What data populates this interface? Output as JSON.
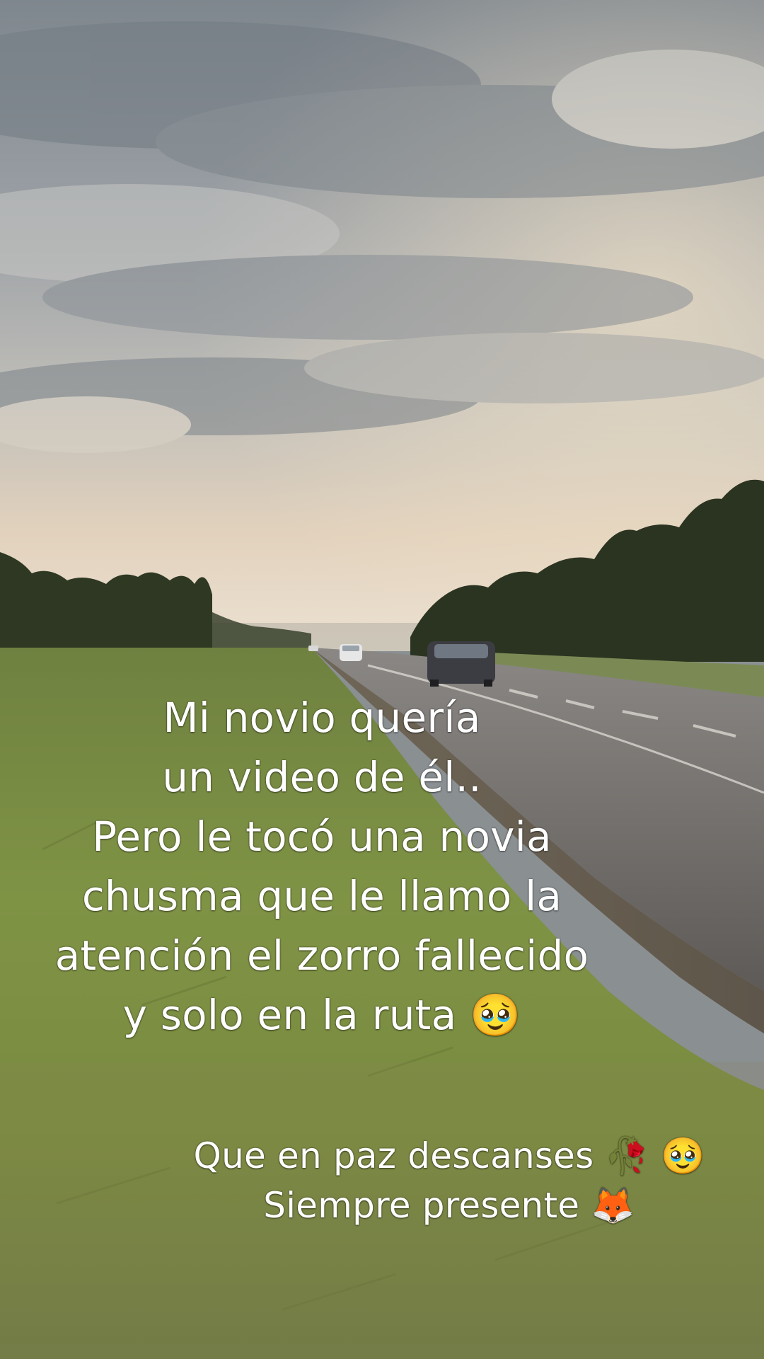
{
  "main_caption": {
    "lines": [
      "Mi novio quería",
      "un video de él..",
      "Pero le tocó una novia",
      "chusma que le llamo la",
      "atención el zorro fallecido",
      "y solo en la ruta 🥹"
    ]
  },
  "sub_caption": {
    "lines": [
      "Que en paz descanses 🥀 🥹",
      "Siempre presente 🦊"
    ]
  },
  "colors": {
    "sky_top": "#8a9299",
    "sky_mid": "#b7b8b5",
    "horizon_glow": "#e9d6bd",
    "treeline": "#2f3a22",
    "road": "#6e6c6b",
    "grass": "#7b8b3d",
    "caption_text": "#ffffff"
  }
}
